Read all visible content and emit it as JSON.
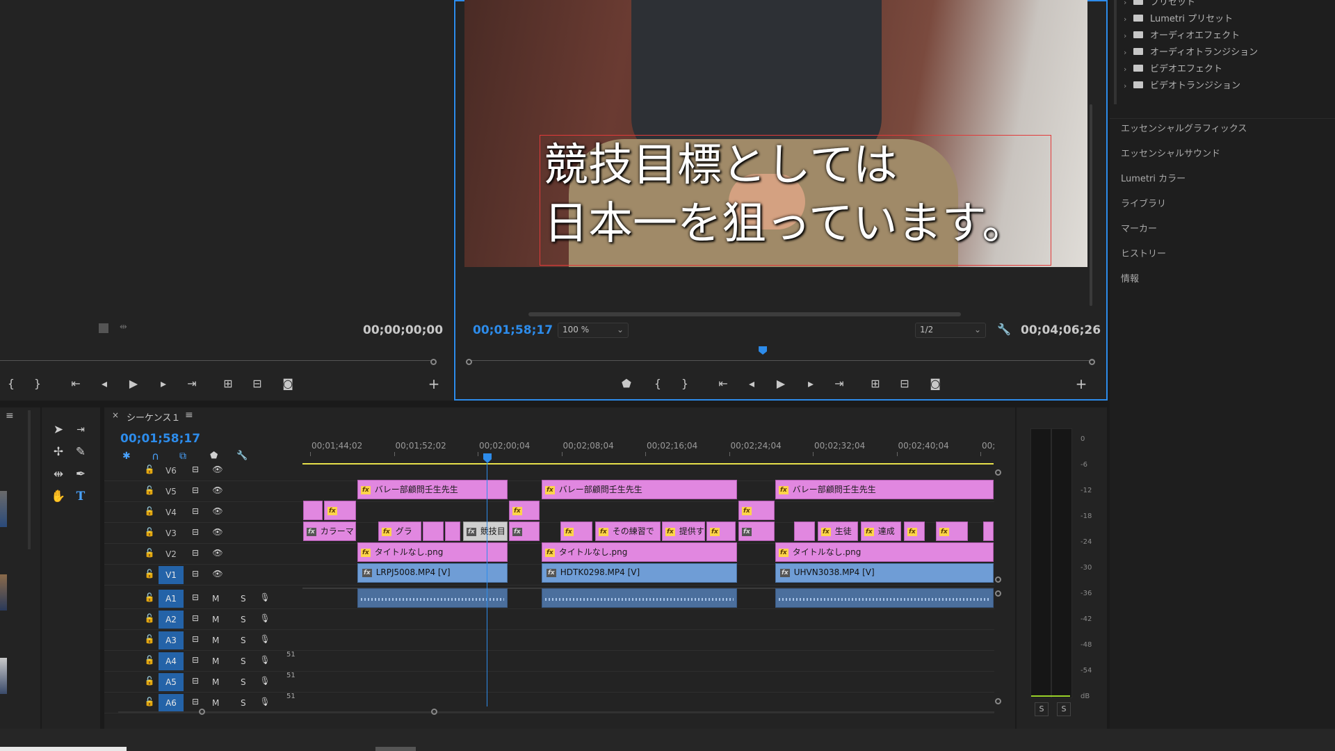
{
  "source_monitor": {
    "timecode": "00;00;00;00"
  },
  "program_monitor": {
    "subtitle_line1": "競技目標としては",
    "subtitle_line2": "日本一を狙っています。",
    "current_timecode": "00;01;58;17",
    "zoom": "100 %",
    "resolution": "1/2",
    "duration": "00;04;06;26",
    "playhead_fraction": 0.47
  },
  "effects_tree": [
    {
      "label": "プリセット"
    },
    {
      "label": "Lumetri プリセット"
    },
    {
      "label": "オーディオエフェクト"
    },
    {
      "label": "オーディオトランジション"
    },
    {
      "label": "ビデオエフェクト"
    },
    {
      "label": "ビデオトランジション"
    }
  ],
  "right_tabs": [
    "エッセンシャルグラフィックス",
    "エッセンシャルサウンド",
    "Lumetri カラー",
    "ライブラリ",
    "マーカー",
    "ヒストリー",
    "情報"
  ],
  "timeline": {
    "tab_close": "×",
    "sequence_name": "シーケンス１",
    "menu_icon": "≡",
    "timecode": "00;01;58;17",
    "ruler_labels": [
      "00;01;44;02",
      "00;01;52;02",
      "00;02;00;04",
      "00;02;08;04",
      "00;02;16;04",
      "00;02;24;04",
      "00;02;32;04",
      "00;02;40;04",
      "00;"
    ],
    "video_tracks": [
      "V6",
      "V5",
      "V4",
      "V3",
      "V2",
      "V1"
    ],
    "audio_tracks": [
      "A1",
      "A2",
      "A3",
      "A4",
      "A5",
      "A6"
    ],
    "audio_m": "M",
    "audio_s": "S",
    "audio_51": "51",
    "clips": {
      "v5_a": "バレー部顧問壬生先生",
      "v5_b": "バレー部顧問壬生先生",
      "v5_c": "バレー部顧問壬生先生",
      "v3_a": "カラーマ",
      "v3_b": "グラ",
      "v3_c": "競技目",
      "v3_d": "その練習で",
      "v3_e": "提供す",
      "v3_f": "生徒",
      "v3_g": "達成",
      "v2_a": "タイトルなし.png",
      "v2_b": "タイトルなし.png",
      "v2_c": "タイトルなし.png",
      "v1_a": "LRPJ5008.MP4 [V]",
      "v1_b": "HDTK0298.MP4 [V]",
      "v1_c": "UHVN3038.MP4 [V]"
    },
    "fx_label": "fx"
  },
  "meter": {
    "db_labels": [
      "0",
      "-6",
      "-12",
      "-18",
      "-24",
      "-30",
      "-36",
      "-42",
      "-48",
      "-54",
      "dB"
    ],
    "solo_left": "S",
    "solo_right": "S"
  }
}
